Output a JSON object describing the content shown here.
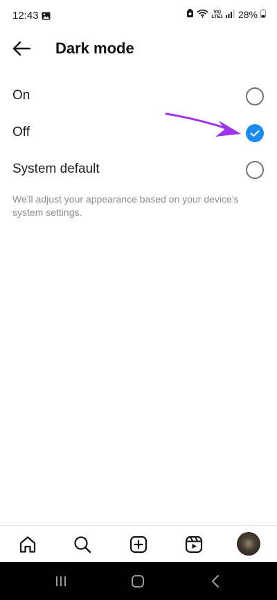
{
  "status_bar": {
    "time": "12:43",
    "volte_top": "Vo)",
    "volte_bottom": "LTE1",
    "battery": "28%"
  },
  "header": {
    "title": "Dark mode"
  },
  "options": [
    {
      "label": "On",
      "selected": false
    },
    {
      "label": "Off",
      "selected": true
    },
    {
      "label": "System default",
      "selected": false
    }
  ],
  "help_text": "We'll adjust your appearance based on your device's system settings.",
  "colors": {
    "accent": "#1a8cf0",
    "annotation_arrow": "#a033f0"
  },
  "bottom_nav": {
    "icons": [
      "home-icon",
      "search-icon",
      "create-post-icon",
      "reels-icon",
      "profile-avatar"
    ]
  },
  "system_nav": {
    "icons": [
      "recents-icon",
      "home-button-icon",
      "back-chevron-icon"
    ]
  }
}
